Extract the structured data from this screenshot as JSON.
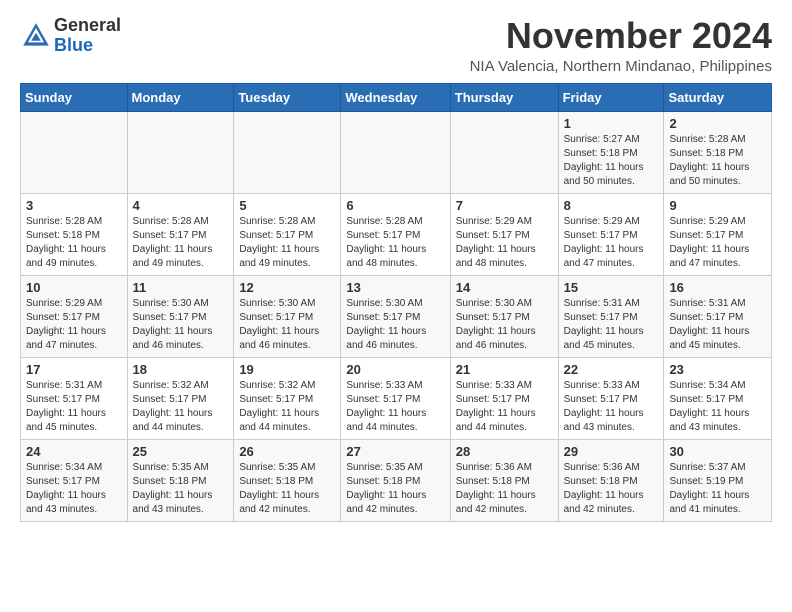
{
  "header": {
    "logo_general": "General",
    "logo_blue": "Blue",
    "month_title": "November 2024",
    "location": "NIA Valencia, Northern Mindanao, Philippines"
  },
  "days_of_week": [
    "Sunday",
    "Monday",
    "Tuesday",
    "Wednesday",
    "Thursday",
    "Friday",
    "Saturday"
  ],
  "weeks": [
    [
      {
        "day": "",
        "info": ""
      },
      {
        "day": "",
        "info": ""
      },
      {
        "day": "",
        "info": ""
      },
      {
        "day": "",
        "info": ""
      },
      {
        "day": "",
        "info": ""
      },
      {
        "day": "1",
        "info": "Sunrise: 5:27 AM\nSunset: 5:18 PM\nDaylight: 11 hours and 50 minutes."
      },
      {
        "day": "2",
        "info": "Sunrise: 5:28 AM\nSunset: 5:18 PM\nDaylight: 11 hours and 50 minutes."
      }
    ],
    [
      {
        "day": "3",
        "info": "Sunrise: 5:28 AM\nSunset: 5:18 PM\nDaylight: 11 hours and 49 minutes."
      },
      {
        "day": "4",
        "info": "Sunrise: 5:28 AM\nSunset: 5:17 PM\nDaylight: 11 hours and 49 minutes."
      },
      {
        "day": "5",
        "info": "Sunrise: 5:28 AM\nSunset: 5:17 PM\nDaylight: 11 hours and 49 minutes."
      },
      {
        "day": "6",
        "info": "Sunrise: 5:28 AM\nSunset: 5:17 PM\nDaylight: 11 hours and 48 minutes."
      },
      {
        "day": "7",
        "info": "Sunrise: 5:29 AM\nSunset: 5:17 PM\nDaylight: 11 hours and 48 minutes."
      },
      {
        "day": "8",
        "info": "Sunrise: 5:29 AM\nSunset: 5:17 PM\nDaylight: 11 hours and 47 minutes."
      },
      {
        "day": "9",
        "info": "Sunrise: 5:29 AM\nSunset: 5:17 PM\nDaylight: 11 hours and 47 minutes."
      }
    ],
    [
      {
        "day": "10",
        "info": "Sunrise: 5:29 AM\nSunset: 5:17 PM\nDaylight: 11 hours and 47 minutes."
      },
      {
        "day": "11",
        "info": "Sunrise: 5:30 AM\nSunset: 5:17 PM\nDaylight: 11 hours and 46 minutes."
      },
      {
        "day": "12",
        "info": "Sunrise: 5:30 AM\nSunset: 5:17 PM\nDaylight: 11 hours and 46 minutes."
      },
      {
        "day": "13",
        "info": "Sunrise: 5:30 AM\nSunset: 5:17 PM\nDaylight: 11 hours and 46 minutes."
      },
      {
        "day": "14",
        "info": "Sunrise: 5:30 AM\nSunset: 5:17 PM\nDaylight: 11 hours and 46 minutes."
      },
      {
        "day": "15",
        "info": "Sunrise: 5:31 AM\nSunset: 5:17 PM\nDaylight: 11 hours and 45 minutes."
      },
      {
        "day": "16",
        "info": "Sunrise: 5:31 AM\nSunset: 5:17 PM\nDaylight: 11 hours and 45 minutes."
      }
    ],
    [
      {
        "day": "17",
        "info": "Sunrise: 5:31 AM\nSunset: 5:17 PM\nDaylight: 11 hours and 45 minutes."
      },
      {
        "day": "18",
        "info": "Sunrise: 5:32 AM\nSunset: 5:17 PM\nDaylight: 11 hours and 44 minutes."
      },
      {
        "day": "19",
        "info": "Sunrise: 5:32 AM\nSunset: 5:17 PM\nDaylight: 11 hours and 44 minutes."
      },
      {
        "day": "20",
        "info": "Sunrise: 5:33 AM\nSunset: 5:17 PM\nDaylight: 11 hours and 44 minutes."
      },
      {
        "day": "21",
        "info": "Sunrise: 5:33 AM\nSunset: 5:17 PM\nDaylight: 11 hours and 44 minutes."
      },
      {
        "day": "22",
        "info": "Sunrise: 5:33 AM\nSunset: 5:17 PM\nDaylight: 11 hours and 43 minutes."
      },
      {
        "day": "23",
        "info": "Sunrise: 5:34 AM\nSunset: 5:17 PM\nDaylight: 11 hours and 43 minutes."
      }
    ],
    [
      {
        "day": "24",
        "info": "Sunrise: 5:34 AM\nSunset: 5:17 PM\nDaylight: 11 hours and 43 minutes."
      },
      {
        "day": "25",
        "info": "Sunrise: 5:35 AM\nSunset: 5:18 PM\nDaylight: 11 hours and 43 minutes."
      },
      {
        "day": "26",
        "info": "Sunrise: 5:35 AM\nSunset: 5:18 PM\nDaylight: 11 hours and 42 minutes."
      },
      {
        "day": "27",
        "info": "Sunrise: 5:35 AM\nSunset: 5:18 PM\nDaylight: 11 hours and 42 minutes."
      },
      {
        "day": "28",
        "info": "Sunrise: 5:36 AM\nSunset: 5:18 PM\nDaylight: 11 hours and 42 minutes."
      },
      {
        "day": "29",
        "info": "Sunrise: 5:36 AM\nSunset: 5:18 PM\nDaylight: 11 hours and 42 minutes."
      },
      {
        "day": "30",
        "info": "Sunrise: 5:37 AM\nSunset: 5:19 PM\nDaylight: 11 hours and 41 minutes."
      }
    ]
  ]
}
